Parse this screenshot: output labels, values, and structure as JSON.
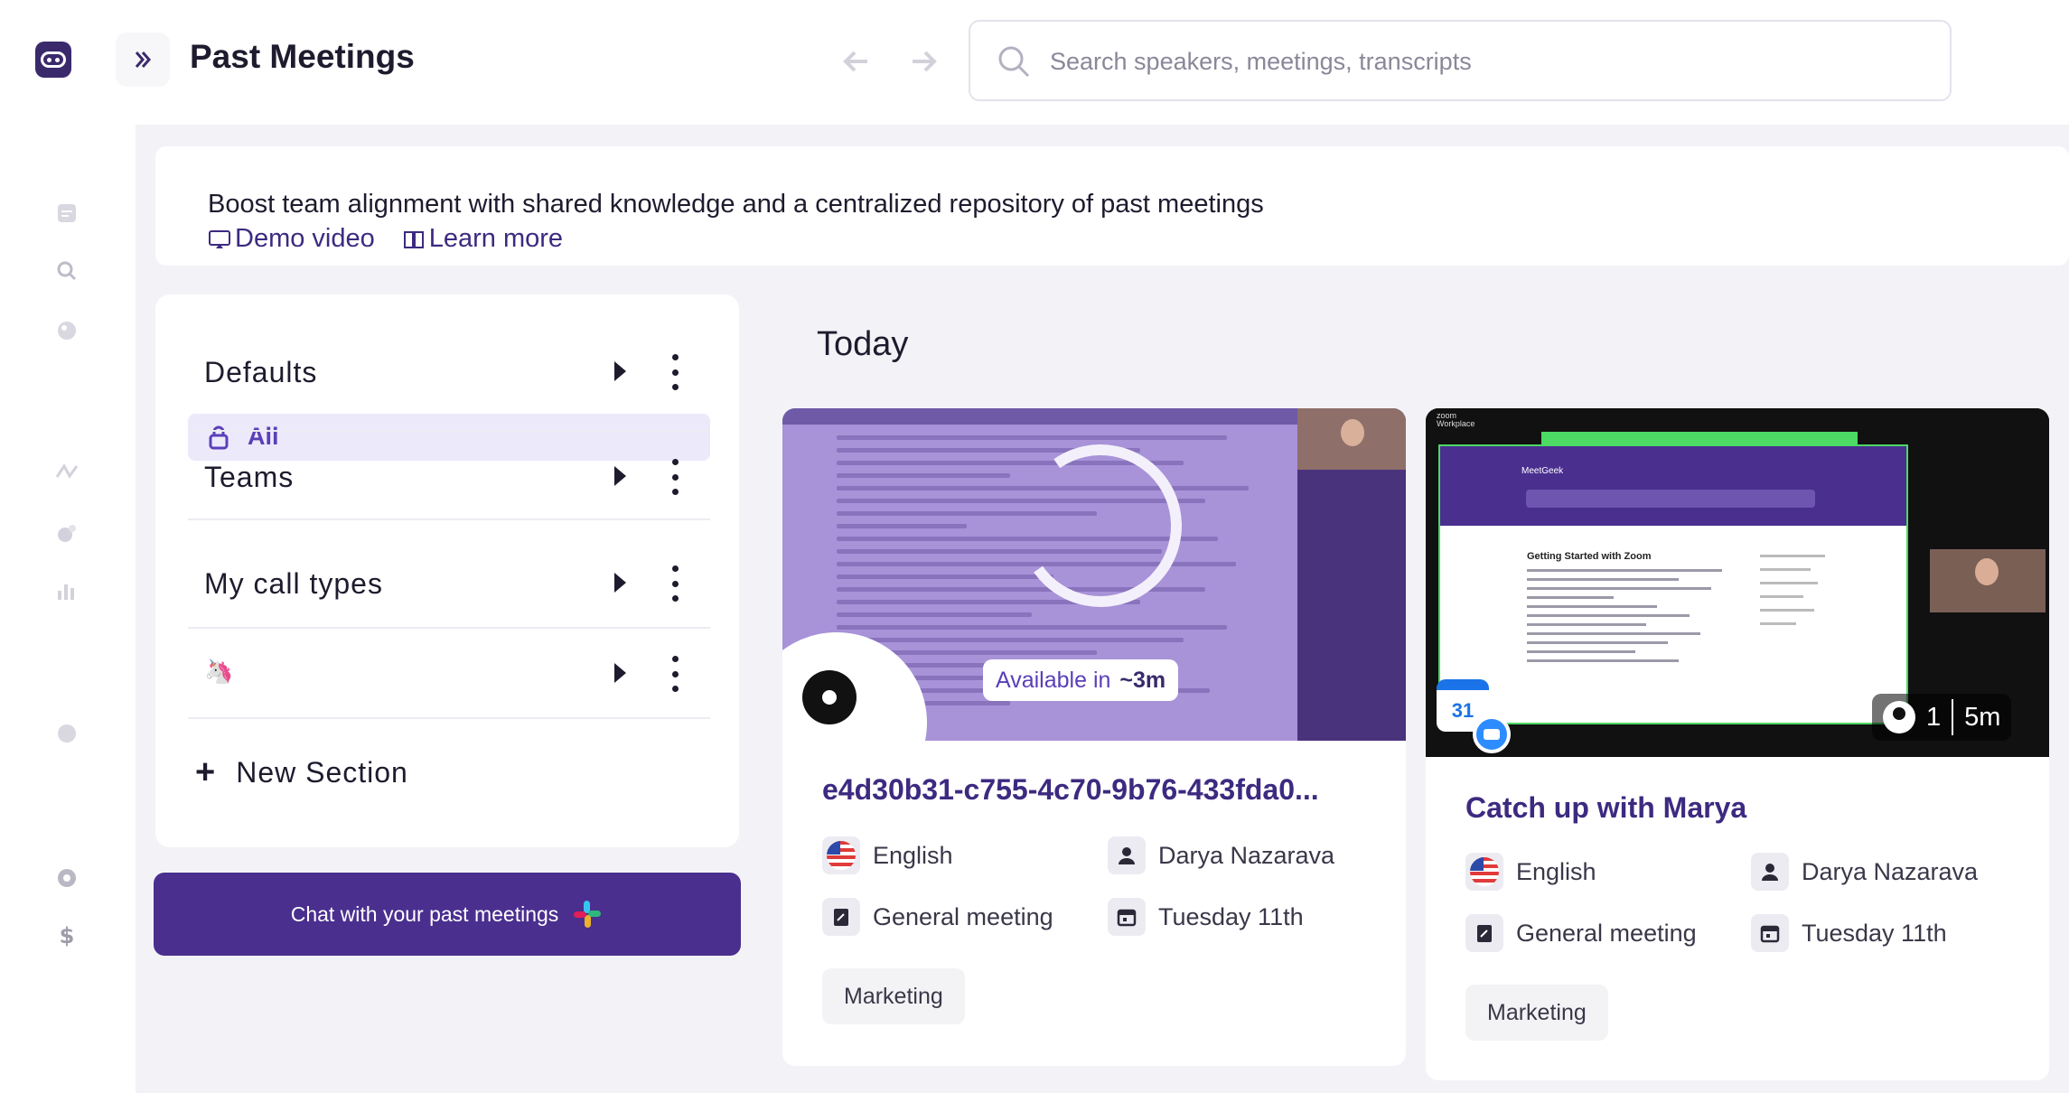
{
  "app": {
    "page_title": "Past Meetings",
    "accent_color": "#4a2f8f",
    "search": {
      "placeholder": "Search speakers, meetings, transcripts"
    }
  },
  "rail": {
    "icons": [
      "app-logo",
      "notes-icon",
      "search-icon",
      "globe-icon",
      "shuffle-icon",
      "chart-bubble-icon",
      "bar-chart-icon",
      "user-icon",
      "settings-icon",
      "dollar-icon"
    ]
  },
  "banner": {
    "text": "Boost team alignment with shared knowledge and a centralized repository of past meetings",
    "demo_video": "Demo video",
    "learn_more": "Learn more"
  },
  "sections": {
    "defaults": "Defaults",
    "all": "All",
    "teams": "Teams",
    "my_call_types": "My call types",
    "custom_emoji": "🦄",
    "new_section": "New Section"
  },
  "chat_button": {
    "label": "Chat with your past meetings"
  },
  "today_label": "Today",
  "meetings": [
    {
      "title": "e4d30b31-c755-4c70-9b76-433fda0...",
      "status_label": "Available in",
      "status_value": "~3m",
      "language": "English",
      "organizer": "Darya Nazarava",
      "type": "General meeting",
      "date": "Tuesday 11th",
      "tag": "Marketing"
    },
    {
      "title": "Catch up with Marya",
      "participants": "1",
      "duration": "5m",
      "calendar_day": "31",
      "language": "English",
      "organizer": "Darya Nazarava",
      "type": "General meeting",
      "date": "Tuesday 11th",
      "tag": "Marketing"
    }
  ]
}
